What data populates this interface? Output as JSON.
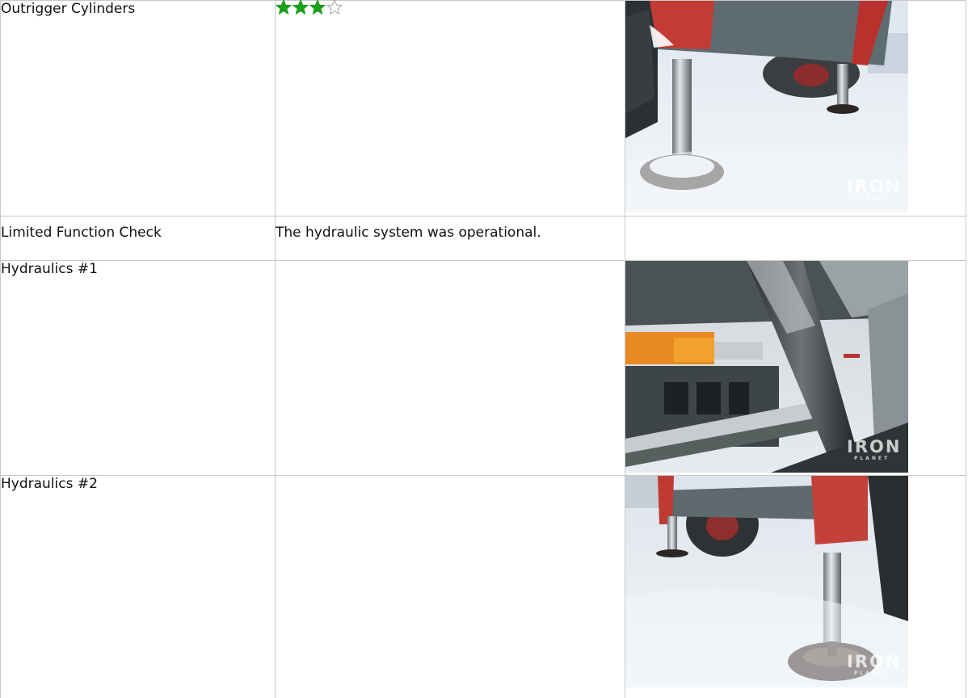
{
  "rows": [
    {
      "label": "Outrigger Cylinders",
      "rating": 3,
      "rating_max": 4,
      "rating_color": "#1aa01a",
      "photo": {
        "icon": "outrigger-cylinder-photo",
        "watermark": "IRON",
        "watermark_sub": "PLANET"
      }
    },
    {
      "label": "Limited Function Check",
      "description": "The hydraulic system was operational."
    },
    {
      "label": "Hydraulics #1",
      "photo": {
        "icon": "hydraulic-cylinder-photo",
        "watermark": "IRON",
        "watermark_sub": "PLANET"
      }
    },
    {
      "label": "Hydraulics #2",
      "photo": {
        "icon": "outrigger-leg-photo",
        "watermark": "IRON",
        "watermark_sub": "PLANET"
      }
    }
  ]
}
